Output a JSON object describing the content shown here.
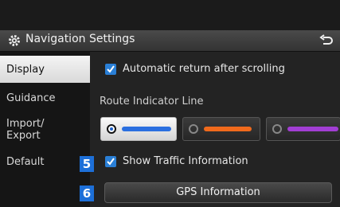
{
  "header": {
    "title": "Navigation Settings",
    "settings_icon": "gear-icon",
    "back_icon": "back-arrow-icon"
  },
  "sidebar": {
    "items": [
      {
        "label": "Display",
        "active": true
      },
      {
        "label": "Guidance",
        "active": false
      },
      {
        "label": "Import/\nExport",
        "active": false
      },
      {
        "label": "Default",
        "active": false
      }
    ]
  },
  "display": {
    "auto_return": {
      "label": "Automatic return after scrolling",
      "checked": true
    },
    "route_line": {
      "title": "Route Indicator Line",
      "options": [
        {
          "color": "#2a6fe0",
          "selected": true
        },
        {
          "color": "#f06a1c",
          "selected": false
        },
        {
          "color": "#a23ed4",
          "selected": false
        }
      ]
    },
    "traffic": {
      "label": "Show Traffic Information",
      "checked": true,
      "badge": "5"
    },
    "gps": {
      "label": "GPS Information",
      "badge": "6"
    }
  },
  "colors": {
    "accent": "#2a7fd6",
    "badge": "#1d6fd8"
  }
}
